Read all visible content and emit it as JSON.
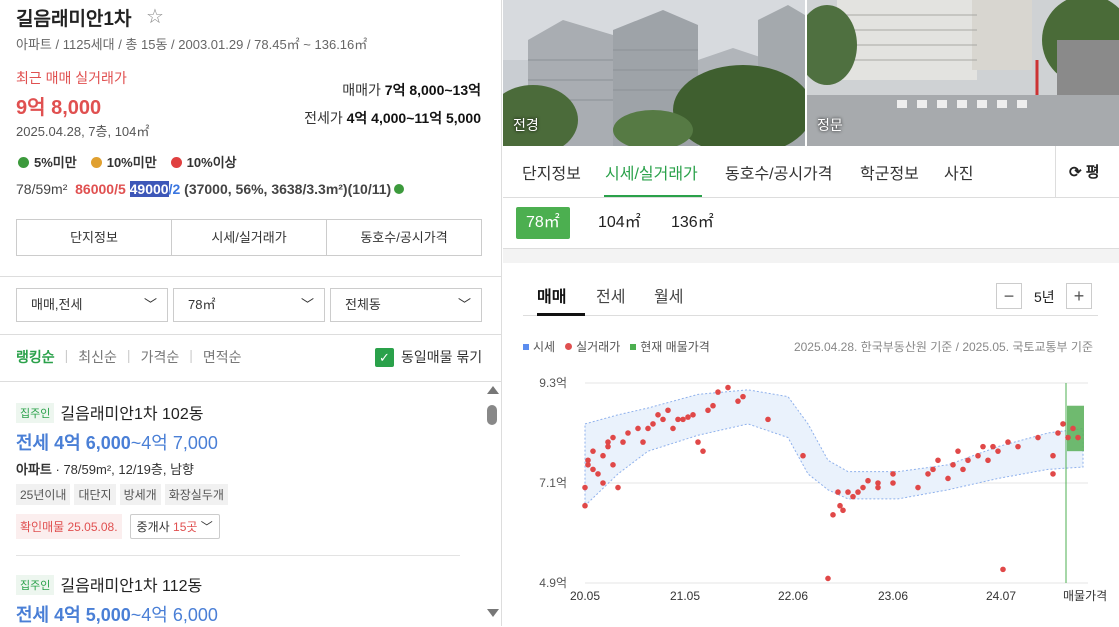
{
  "complex": {
    "name": "길음래미안1차",
    "summary": "아파트 / 1125세대 / 총 15동 / 2003.01.29 / 78.45㎡ ~ 136.16㎡",
    "recent_label": "최근 매매 실거래가",
    "recent_price": "9억 8,000",
    "recent_detail": "2025.04.28, 7층, 104㎡",
    "sale_label": "매매가",
    "sale_value": "7억 8,000~13억",
    "jeonse_label": "전세가",
    "jeonse_value": "4억 4,000~11억 5,000"
  },
  "legend": [
    {
      "label": "5%미만",
      "color": "#3c9a3c"
    },
    {
      "label": "10%미만",
      "color": "#e0a030"
    },
    {
      "label": "10%이상",
      "color": "#e04040"
    }
  ],
  "ratio": {
    "area": "78/59m²",
    "sale": "86000/5",
    "jeonse_hl": "49000",
    "jeonse_rest": "/2",
    "extra": "(37000, 56%, 3638/3.3m²)(10/11)"
  },
  "left_tabs": [
    "단지정보",
    "시세/실거래가",
    "동호수/공시가격"
  ],
  "filters": {
    "trade": "매매,전세",
    "area": "78㎡",
    "dong": "전체동"
  },
  "sorts": [
    "랭킹순",
    "최신순",
    "가격순",
    "면적순"
  ],
  "group_same": "동일매물 묶기",
  "listings": [
    {
      "source": "집주인",
      "name": "길음래미안1차 102동",
      "price_type": "전세",
      "price": "4억 6,000",
      "price_range": "~4억 7,000",
      "type": "아파트",
      "spec": "78/59m², 12/19층, 남향",
      "tags": [
        "25년이내",
        "대단지",
        "방세개",
        "화장실두개"
      ],
      "confirm": "확인매물 25.05.08.",
      "agent_label": "중개사",
      "agent_count": "15곳"
    },
    {
      "source": "집주인",
      "name": "길음래미안1차 112동",
      "price_type": "전세",
      "price": "4억 5,000",
      "price_range": "~4억 6,000"
    }
  ],
  "photos": [
    {
      "label": "전경"
    },
    {
      "label": "정문"
    }
  ],
  "nav_tabs": [
    "단지정보",
    "시세/실거래가",
    "동호수/공시가격",
    "학군정보",
    "사진"
  ],
  "pyeong": "평",
  "areas": [
    "78㎡",
    "104㎡",
    "136㎡"
  ],
  "chart_tabs": [
    "매매",
    "전세",
    "월세"
  ],
  "zoom": {
    "minus": "−",
    "value": "5년",
    "plus": "+"
  },
  "chart_legend": [
    {
      "label": "시세",
      "color": "#5b8def"
    },
    {
      "label": "실거래가",
      "color": "#e05050"
    },
    {
      "label": "현재 매물가격",
      "color": "#4caf50"
    }
  ],
  "chart_source": "2025.04.28. 한국부동산원 기준 / 2025.05. 국토교통부 기준",
  "chart_data": {
    "type": "scatter",
    "y_tick_labels": [
      "9.3억",
      "7.1억",
      "4.9억"
    ],
    "y_ticks": [
      9.3,
      7.1,
      4.9
    ],
    "ylim": [
      4.9,
      9.3
    ],
    "x_tick_labels": [
      "20.05",
      "21.05",
      "22.06",
      "23.06",
      "24.07",
      "매물가격"
    ],
    "x_ticks": [
      2020.37,
      2021.37,
      2022.45,
      2023.45,
      2024.53
    ],
    "xlim": [
      2020.37,
      2025.4
    ],
    "band_upper": [
      [
        2020.37,
        8.4
      ],
      [
        2020.7,
        8.6
      ],
      [
        2021.0,
        8.75
      ],
      [
        2021.5,
        9.05
      ],
      [
        2022.0,
        9.15
      ],
      [
        2022.4,
        9.0
      ],
      [
        2022.6,
        8.4
      ],
      [
        2022.8,
        7.6
      ],
      [
        2023.0,
        7.35
      ],
      [
        2023.5,
        7.35
      ],
      [
        2024.0,
        7.5
      ],
      [
        2024.5,
        7.9
      ],
      [
        2025.0,
        8.2
      ],
      [
        2025.35,
        8.3
      ]
    ],
    "band_lower": [
      [
        2020.37,
        6.6
      ],
      [
        2020.7,
        7.3
      ],
      [
        2021.0,
        7.8
      ],
      [
        2021.5,
        8.15
      ],
      [
        2022.0,
        8.4
      ],
      [
        2022.4,
        8.1
      ],
      [
        2022.6,
        7.3
      ],
      [
        2022.8,
        6.95
      ],
      [
        2023.0,
        6.75
      ],
      [
        2023.5,
        6.75
      ],
      [
        2024.0,
        6.95
      ],
      [
        2024.5,
        7.2
      ],
      [
        2025.0,
        7.4
      ],
      [
        2025.35,
        7.45
      ]
    ],
    "trades": [
      [
        2020.37,
        6.6
      ],
      [
        2020.37,
        7.0
      ],
      [
        2020.4,
        7.5
      ],
      [
        2020.4,
        7.6
      ],
      [
        2020.45,
        7.4
      ],
      [
        2020.45,
        7.8
      ],
      [
        2020.5,
        7.3
      ],
      [
        2020.55,
        7.7
      ],
      [
        2020.55,
        7.1
      ],
      [
        2020.6,
        7.9
      ],
      [
        2020.6,
        8.0
      ],
      [
        2020.65,
        7.5
      ],
      [
        2020.65,
        8.1
      ],
      [
        2020.7,
        7.0
      ],
      [
        2020.75,
        8.0
      ],
      [
        2020.8,
        8.2
      ],
      [
        2020.9,
        8.3
      ],
      [
        2020.95,
        8.0
      ],
      [
        2021.0,
        8.3
      ],
      [
        2021.05,
        8.4
      ],
      [
        2021.1,
        8.6
      ],
      [
        2021.15,
        8.5
      ],
      [
        2021.2,
        8.7
      ],
      [
        2021.25,
        8.3
      ],
      [
        2021.3,
        8.5
      ],
      [
        2021.35,
        8.5
      ],
      [
        2021.4,
        8.55
      ],
      [
        2021.45,
        8.6
      ],
      [
        2021.5,
        8.0
      ],
      [
        2021.55,
        7.8
      ],
      [
        2021.6,
        8.7
      ],
      [
        2021.65,
        8.8
      ],
      [
        2021.7,
        9.1
      ],
      [
        2021.8,
        9.2
      ],
      [
        2021.9,
        8.9
      ],
      [
        2021.95,
        9.0
      ],
      [
        2022.2,
        8.5
      ],
      [
        2022.55,
        7.7
      ],
      [
        2022.8,
        5.0
      ],
      [
        2022.85,
        6.4
      ],
      [
        2022.9,
        6.9
      ],
      [
        2022.92,
        6.6
      ],
      [
        2022.95,
        6.5
      ],
      [
        2023.0,
        6.9
      ],
      [
        2023.05,
        6.8
      ],
      [
        2023.1,
        6.9
      ],
      [
        2023.15,
        7.0
      ],
      [
        2023.2,
        7.15
      ],
      [
        2023.3,
        7.0
      ],
      [
        2023.3,
        7.1
      ],
      [
        2023.45,
        7.1
      ],
      [
        2023.45,
        7.3
      ],
      [
        2023.7,
        7.0
      ],
      [
        2023.8,
        7.3
      ],
      [
        2023.85,
        7.4
      ],
      [
        2023.9,
        7.6
      ],
      [
        2024.0,
        7.2
      ],
      [
        2024.05,
        7.5
      ],
      [
        2024.1,
        7.8
      ],
      [
        2024.15,
        7.4
      ],
      [
        2024.2,
        7.6
      ],
      [
        2024.3,
        7.7
      ],
      [
        2024.35,
        7.9
      ],
      [
        2024.4,
        7.6
      ],
      [
        2024.45,
        7.9
      ],
      [
        2024.5,
        7.8
      ],
      [
        2024.55,
        5.2
      ],
      [
        2024.6,
        8.0
      ],
      [
        2024.7,
        7.9
      ],
      [
        2024.9,
        8.1
      ],
      [
        2025.05,
        7.3
      ],
      [
        2025.05,
        7.7
      ],
      [
        2025.1,
        8.2
      ],
      [
        2025.15,
        8.4
      ],
      [
        2025.2,
        8.1
      ],
      [
        2025.25,
        8.3
      ],
      [
        2025.3,
        8.1
      ]
    ],
    "listing_range": [
      7.8,
      8.8
    ]
  }
}
